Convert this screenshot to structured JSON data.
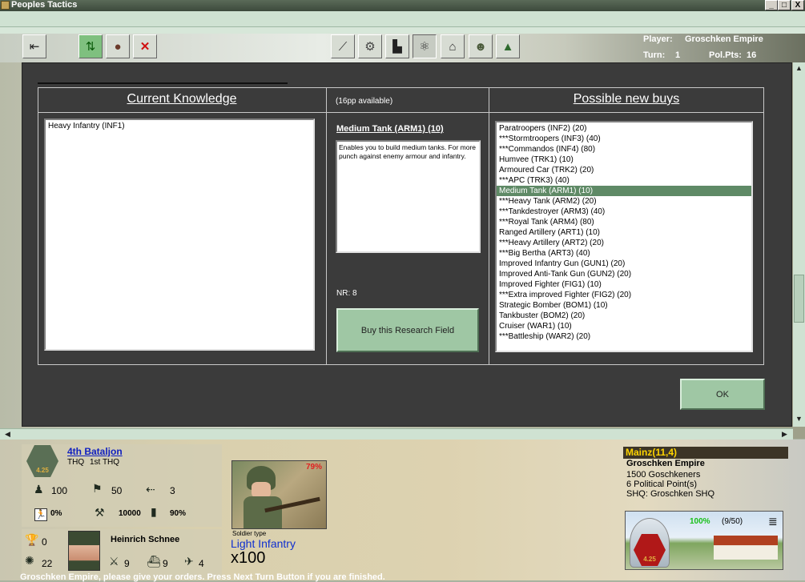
{
  "window": {
    "title": "Peoples Tactics",
    "controls": [
      "_",
      "□",
      "X"
    ]
  },
  "toolbar": {
    "left_buttons": [
      "back-arrow-icon",
      "swap-arrows-icon",
      "officer-icon",
      "cancel-x-icon"
    ],
    "right_buttons": [
      "mortar-icon",
      "gears-icon",
      "factory-icon",
      "atom-icon",
      "parliament-icon",
      "generals-icon",
      "landscape-icon"
    ]
  },
  "player_info": {
    "player_label": "Player:",
    "player_name": "Groschken Empire",
    "turn_label": "Turn:",
    "turn_value": "1",
    "polpts_label": "Pol.Pts:",
    "polpts_value": "16"
  },
  "research": {
    "current_knowledge_title": "Current Knowledge",
    "available_text": "(16pp available)",
    "possible_buys_title": "Possible new buys",
    "current_knowledge": [
      "Heavy Infantry (INF1)"
    ],
    "selected_field_title": "Medium Tank (ARM1) (10)",
    "selected_field_description": "Enables you to build medium tanks. For more punch against enemy armour and infantry.",
    "nr_text": "NR: 8",
    "buy_button": "Buy this Research Field",
    "ok_button": "OK",
    "selected_index": 6,
    "possible_buys": [
      "Paratroopers (INF2) (20)",
      "***Stormtroopers (INF3) (40)",
      "***Commandos (INF4) (80)",
      "Humvee (TRK1) (10)",
      "Armoured Car (TRK2) (20)",
      "***APC (TRK3) (40)",
      "Medium Tank (ARM1) (10)",
      "***Heavy Tank (ARM2) (20)",
      "***Tankdestroyer (ARM3) (40)",
      "***Royal Tank (ARM4) (80)",
      "Ranged Artillery (ART1) (10)",
      "***Heavy Artillery (ART2) (20)",
      "***Big Bertha (ART3) (40)",
      "Improved Infantry Gun (GUN1) (20)",
      "Improved Anti-Tank Gun (GUN2) (20)",
      "Improved Fighter (FIG1) (10)",
      "***Extra improved Fighter (FIG2) (20)",
      "Strategic Bomber (BOM1) (10)",
      "Tankbuster (BOM2) (20)",
      "Cruiser (WAR1) (10)",
      "***Battleship (WAR2) (20)"
    ]
  },
  "unit": {
    "badge": "4.25",
    "name": "4th Bataljon",
    "type": "THQ",
    "hq": "1st THQ",
    "men": "100",
    "morale": "50",
    "moves": "3",
    "retreat": "0%",
    "supply": "10000",
    "fuel": "90%"
  },
  "commander": {
    "medals": "0",
    "name": "Heinrich Schnee",
    "skill1": "22",
    "skill2": "9",
    "skill3": "9",
    "skill4": "4"
  },
  "soldier": {
    "percent": "79%",
    "caption": "Soldier type",
    "type": "Light Infantry",
    "count": "x100"
  },
  "city": {
    "name": "Mainz(11,4)",
    "owner": "Groschken Empire",
    "population": "1500 Goschkeners",
    "political": "6 Political Point(s)",
    "shq": "SHQ: Groschken SHQ",
    "percent": "100%",
    "capacity": "(9/50)",
    "badge": "4.25"
  },
  "status": "Groschken Empire, please give your orders. Press Next Turn Button if you are finished."
}
